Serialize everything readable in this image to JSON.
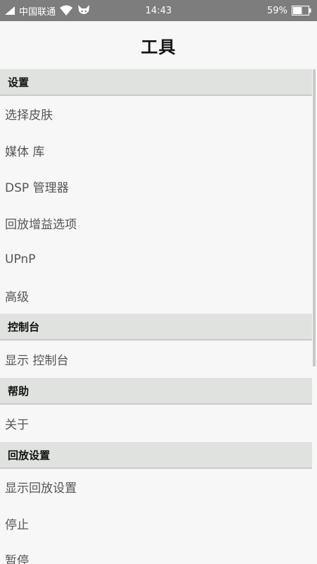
{
  "status_bar": {
    "carrier": "中国联通",
    "time": "14:43",
    "battery_percent": "59%",
    "battery_level": 0.59
  },
  "header": {
    "title": "工具"
  },
  "sections": [
    {
      "header": "设置",
      "items": [
        "选择皮肤",
        "媒体 库",
        "DSP 管理器",
        "回放增益选项",
        "UPnP",
        "高级"
      ]
    },
    {
      "header": "控制台",
      "items": [
        "显示 控制台"
      ]
    },
    {
      "header": "帮助",
      "items": [
        "关于"
      ]
    },
    {
      "header": "回放设置",
      "items": [
        "显示回放设置",
        "停止",
        "暂停"
      ]
    }
  ],
  "colors": {
    "status_bar_bg": "#7d7d7d",
    "section_header_bg": "#dfe2de",
    "page_bg": "#f7f7f7"
  }
}
